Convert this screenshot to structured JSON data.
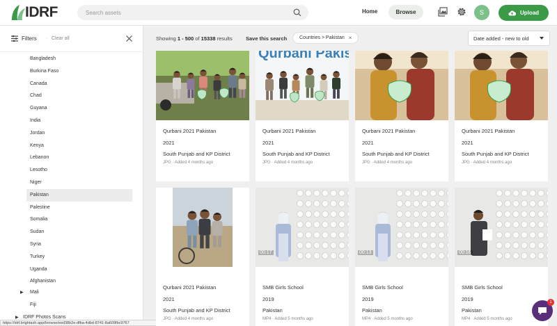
{
  "header": {
    "logo_text": "IDRF",
    "search_placeholder": "Search assets",
    "nav": {
      "home": "Home",
      "browse": "Browse"
    },
    "avatar_initial": "S",
    "upload_label": "Upload",
    "colors": {
      "brand_green": "#3a9a48",
      "avatar": "#7cc08a"
    }
  },
  "sidebar": {
    "filters_label": "Filters",
    "clear_all": "Clear all",
    "countries": [
      "Bangladesh",
      "Burkina Faso",
      "Canada",
      "Chad",
      "Guyana",
      "India",
      "Jordan",
      "Kenya",
      "Lebanon",
      "Lesotho",
      "Niger",
      "Pakistan",
      "Palestine",
      "Somalia",
      "Sudan",
      "Syria",
      "Turkey",
      "Uganda",
      "Afghanistan"
    ],
    "selected_country": "Pakistan",
    "more_items": [
      {
        "label": "Mali",
        "icon": "caret-right-icon"
      },
      {
        "label": "Fiji",
        "icon": ""
      },
      {
        "label": "IDRF Photos Scans",
        "icon": "caret-right-icon"
      }
    ]
  },
  "status_url": "https://idrf.brightash.app/browse/eed38b2e-dfba-4dbd-8741-8a609fbc9767",
  "toolbar": {
    "showing_prefix": "Showing ",
    "range": "1 - 500",
    "of_text": " of ",
    "total": "15338",
    "results_suffix": " results",
    "save_search": "Save this search",
    "chip_label": "Countries > Pakistan",
    "chip_close": "×",
    "sort_label": "Date added - new to old"
  },
  "assets": [
    {
      "title": "Qurbani 2021 Pakistan",
      "year": "2021",
      "location": "South Punjab and KP District",
      "type": "JPG",
      "added": "Added 4 months ago",
      "duration": ""
    },
    {
      "title": "Qurbani 2021 Pakistan",
      "year": "2021",
      "location": "South Punjab and KP District",
      "type": "JPG",
      "added": "Added 4 months ago",
      "duration": ""
    },
    {
      "title": "Qurbani 2021 Pakistan",
      "year": "2021",
      "location": "South Punjab and KP District",
      "type": "JPG",
      "added": "Added 4 months ago",
      "duration": ""
    },
    {
      "title": "Qurbani 2021 Pakistan",
      "year": "2021",
      "location": "South Punjab and KP District",
      "type": "JPG",
      "added": "Added 4 months ago",
      "duration": ""
    },
    {
      "title": "Qurbani 2021 Pakistan",
      "year": "2021",
      "location": "South Punjab and KP District",
      "type": "JPG",
      "added": "Added 4 months ago",
      "duration": ""
    },
    {
      "title": "SMB Girls School",
      "year": "2019",
      "location": "Pakistan",
      "type": "MP4",
      "added": "Added 5 months ago",
      "duration": "00:17"
    },
    {
      "title": "SMB Girls School",
      "year": "2019",
      "location": "Pakistan",
      "type": "MP4",
      "added": "Added 5 months ago",
      "duration": "00:13"
    },
    {
      "title": "SMB Girls School",
      "year": "2019",
      "location": "Pakistan",
      "type": "MP4",
      "added": "Added 5 months ago",
      "duration": "00:16"
    }
  ],
  "thumb_banner_text": "Qurbani Pakistan",
  "chat_badge": "1"
}
